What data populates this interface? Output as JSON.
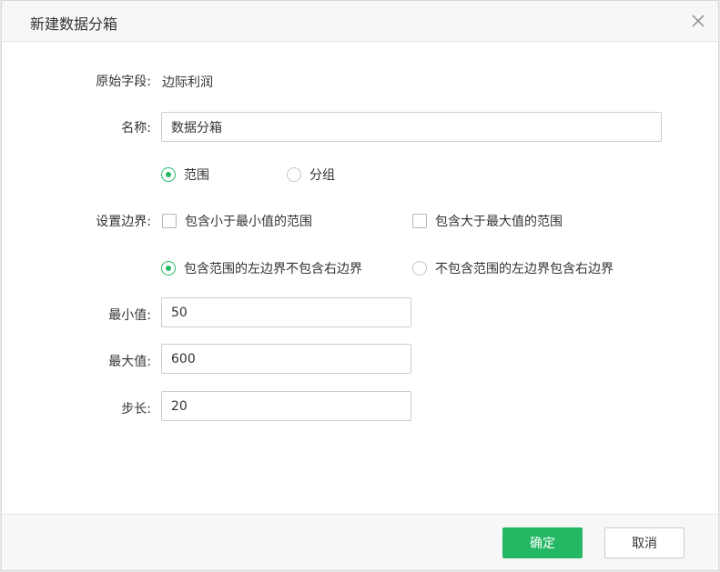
{
  "dialog": {
    "title": "新建数据分箱",
    "close_icon": "close-icon"
  },
  "form": {
    "source_field": {
      "label": "原始字段:",
      "value": "边际利润"
    },
    "name": {
      "label": "名称:",
      "value": "数据分箱"
    },
    "mode": {
      "options": [
        {
          "label": "范围",
          "checked": true
        },
        {
          "label": "分组",
          "checked": false
        }
      ]
    },
    "boundary": {
      "label": "设置边界:",
      "include_below_min": {
        "label": "包含小于最小值的范围",
        "checked": false
      },
      "include_above_max": {
        "label": "包含大于最大值的范围",
        "checked": false
      },
      "edge_options": [
        {
          "label": "包含范围的左边界不包含右边界",
          "checked": true
        },
        {
          "label": "不包含范围的左边界包含右边界",
          "checked": false
        }
      ]
    },
    "min": {
      "label": "最小值:",
      "value": "50"
    },
    "max": {
      "label": "最大值:",
      "value": "600"
    },
    "step": {
      "label": "步长:",
      "value": "20"
    }
  },
  "footer": {
    "confirm_label": "确定",
    "cancel_label": "取消"
  },
  "colors": {
    "accent": "#25b864",
    "border": "#cccccc",
    "header_bg": "#f7f7f7"
  }
}
